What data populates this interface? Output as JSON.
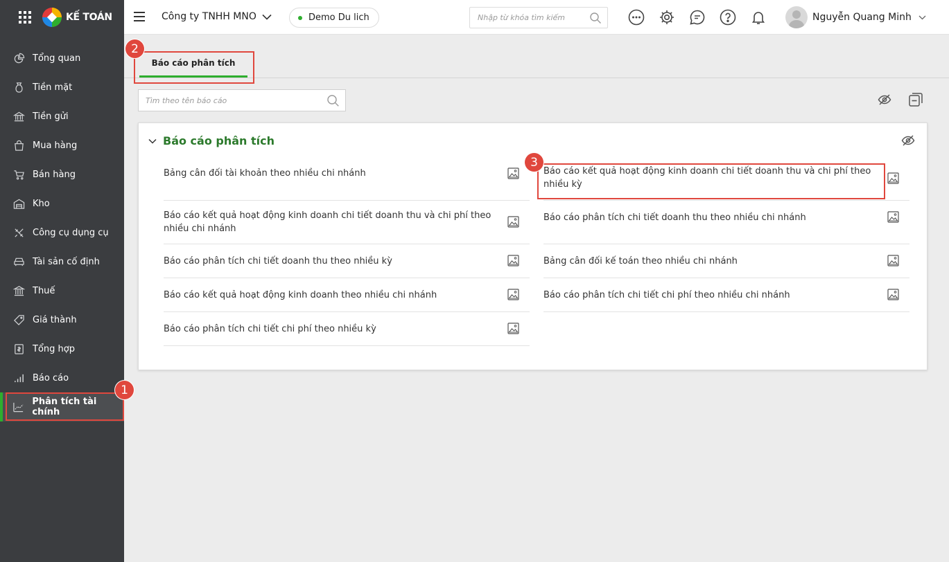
{
  "brand": {
    "name": "KẾ TOÁN"
  },
  "sidebar": {
    "items": [
      {
        "label": "Tổng quan",
        "icon": "pie-chart-icon"
      },
      {
        "label": "Tiền mặt",
        "icon": "money-bag-icon"
      },
      {
        "label": "Tiền gửi",
        "icon": "bank-icon"
      },
      {
        "label": "Mua hàng",
        "icon": "shopping-bag-icon"
      },
      {
        "label": "Bán hàng",
        "icon": "cart-icon"
      },
      {
        "label": "Kho",
        "icon": "warehouse-icon"
      },
      {
        "label": "Công cụ dụng cụ",
        "icon": "tools-icon"
      },
      {
        "label": "Tài sản cố định",
        "icon": "car-icon"
      },
      {
        "label": "Thuế",
        "icon": "government-icon"
      },
      {
        "label": "Giá thành",
        "icon": "price-tag-icon"
      },
      {
        "label": "Tổng hợp",
        "icon": "ledger-icon"
      },
      {
        "label": "Báo cáo",
        "icon": "bar-chart-icon"
      },
      {
        "label": "Phân tích tài chính",
        "icon": "trend-chart-icon",
        "active": true
      }
    ]
  },
  "header": {
    "company": "Công ty TNHH MNO",
    "database": "Demo Du lich",
    "search_placeholder": "Nhập từ khóa tìm kiếm",
    "user_name": "Nguyễn Quang Minh"
  },
  "tabs": [
    {
      "label": "Báo cáo phân tích",
      "active": true
    }
  ],
  "report_search": {
    "placeholder": "Tìm theo tên báo cáo"
  },
  "group": {
    "title": "Báo cáo phân tích",
    "reports_left": [
      "Bảng cân đối tài khoản theo nhiều chi nhánh",
      "Báo cáo kết quả hoạt động kinh doanh chi tiết doanh thu và chi phí theo nhiều chi nhánh",
      "Báo cáo phân tích chi tiết doanh thu theo nhiều kỳ",
      "Báo cáo kết quả hoạt động kinh doanh theo nhiều chi nhánh",
      "Báo cáo phân tích chi tiết chi phí theo nhiều kỳ"
    ],
    "reports_right": [
      "Báo cáo kết quả hoạt động kinh doanh chi tiết doanh thu và chi phí theo nhiều kỳ",
      "Báo cáo phân tích chi tiết doanh thu theo nhiều chi nhánh",
      "Bảng cân đối kế toán theo nhiều chi nhánh",
      "Báo cáo phân tích chi tiết chi phí theo nhiều chi nhánh"
    ]
  },
  "annotations": {
    "step1": "1",
    "step2": "2",
    "step3": "3"
  },
  "colors": {
    "accent": "#2eae2e",
    "sidebar": "#3b3d40",
    "highlight": "#e0473d",
    "group_title": "#2c7a2c"
  }
}
